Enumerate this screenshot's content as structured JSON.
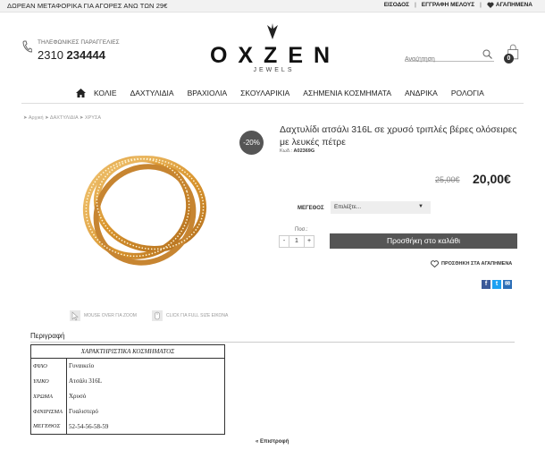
{
  "topbar": {
    "promo": "ΔΩΡΕΑΝ ΜΕΤΑΦΟΡΙΚΑ ΓΙΑ ΑΓΟΡΕΣ ΑΝΩ ΤΩΝ 29€",
    "login": "ΕΙΣΟΔΟΣ",
    "register": "ΕΓΓΡΑΦΗ ΜΕΛΟΥΣ",
    "favorites": "ΑΓΑΠΗΜΕΝΑ"
  },
  "header": {
    "phone_label": "ΤΗΛΕΦΩΝΙΚΕΣ ΠΑΡΑΓΓΕΛΙΕΣ",
    "phone_prefix": "2310",
    "phone_number": "234444",
    "logo_text": "OXZEN",
    "logo_sub": "JEWELS",
    "search_placeholder": "Αναζήτηση",
    "cart_count": "0"
  },
  "nav": {
    "items": [
      "ΚΟΛΙΕ",
      "ΔΑΧΤΥΛΙΔΙΑ",
      "ΒΡΑΧΙΟΛΙΑ",
      "ΣΚΟΥΛΑΡΙΚΙΑ",
      "ΑΣΗΜΕΝΙΑ ΚΟΣΜΗΜΑΤΑ",
      "ΑΝΔΡΙΚΑ",
      "ΡΟΛΟΓΙΑ"
    ]
  },
  "breadcrumb": "➤ Αρχική ➤ ΔΑΧΤΥΛΙΔΙΑ ➤ ΧΡΥΣΑ",
  "product": {
    "discount": "-20%",
    "title": "Δαχτυλίδι ατσάλι 316L σε χρυσό τριπλές βέρες ολόσειρες με λευκές πέτρε",
    "code_label": "Κωδ.:",
    "code": "A02369G",
    "old_price": "25,00€",
    "new_price": "20,00€",
    "size_label": "ΜΕΓΕΘΟΣ",
    "size_placeholder": "Επιλέξτε...",
    "qty_label": "Ποσ.:",
    "qty_minus": "-",
    "qty_value": "1",
    "qty_plus": "+",
    "add_to_cart": "Προσθήκη στο καλάθι",
    "add_to_favorites": "ΠΡΟΣΘΗΚΗ ΣΤΑ ΑΓΑΠΗΜΕΝΑ",
    "hint_zoom": "MOUSE OVER ΓΙΑ ZOOM",
    "hint_fullsize": "CLICK ΓΙΑ FULL SIZE ΕΙΚΟΝΑ"
  },
  "social": [
    {
      "icon": "facebook-icon",
      "glyph": "f",
      "color": "#3b5998"
    },
    {
      "icon": "twitter-icon",
      "glyph": "t",
      "color": "#1da1f2"
    },
    {
      "icon": "email-icon",
      "glyph": "✉",
      "color": "#2d6fb7"
    }
  ],
  "description": {
    "tab": "Περιγραφή",
    "table_title": "ΧΑΡΑΚΤΗΡΙΣΤΙΚΑ ΚΟΣΜΗΜΑΤΟΣ",
    "rows": [
      {
        "k": "ΦΥΛΟ",
        "v": "Γυναικείο"
      },
      {
        "k": "ΥΛΙΚΟ",
        "v": "Ατσάλι 316L"
      },
      {
        "k": "ΧΡΩΜΑ",
        "v": "Χρυσό"
      },
      {
        "k": "ΦΙΝΙΡΙΣΜΑ",
        "v": "Γυαλιστερό"
      },
      {
        "k": "ΜΕΓΕΘΟΣ",
        "v": "52-54-56-58-59"
      }
    ]
  },
  "back_link": "« Επιστροφή"
}
